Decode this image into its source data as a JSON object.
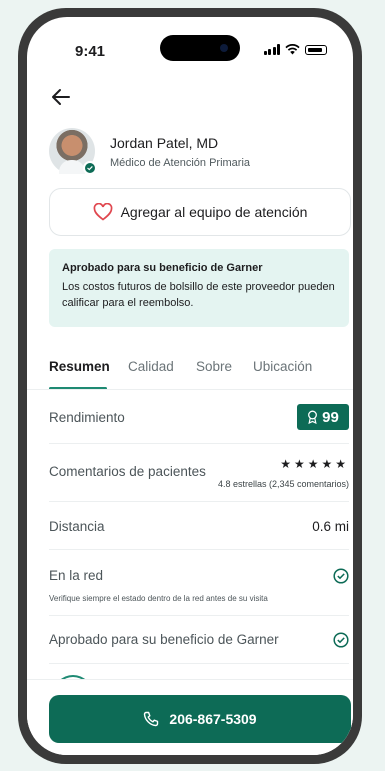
{
  "status_bar": {
    "time": "9:41"
  },
  "doctor": {
    "name": "Jordan Patel, MD",
    "role": "Médico de Atención Primaria"
  },
  "add_button_label": "Agregar al equipo de atención",
  "banner": {
    "title": "Aprobado para su beneficio de Garner",
    "text": "Los costos futuros de bolsillo de este proveedor pueden calificar para el reembolso."
  },
  "tabs": [
    "Resumen",
    "Calidad",
    "Sobre",
    "Ubicación"
  ],
  "rows": {
    "performance": {
      "label": "Rendimiento",
      "score": "99"
    },
    "reviews": {
      "label": "Comentarios de pacientes",
      "stars": "★★★★★",
      "rating": 4.8,
      "summary": "4.8 estrellas (2,345  comentarios)"
    },
    "distance": {
      "label": "Distancia",
      "value": "0.6 mi"
    },
    "network": {
      "label": "En la red",
      "note": "Verifique siempre el estado dentro de la red antes de su visita"
    },
    "garner": {
      "label": "Aprobado para su beneficio de Garner"
    }
  },
  "call_button": {
    "phone": "206-867-5309"
  },
  "colors": {
    "accent": "#0d6b56",
    "tab_underline": "#1e8a73",
    "banner_bg": "#e4f4f1",
    "heart": "#e0474f"
  },
  "icons": [
    "back-arrow-icon",
    "heart-icon",
    "award-icon",
    "check-circle-icon",
    "phone-icon",
    "verified-badge-icon"
  ]
}
